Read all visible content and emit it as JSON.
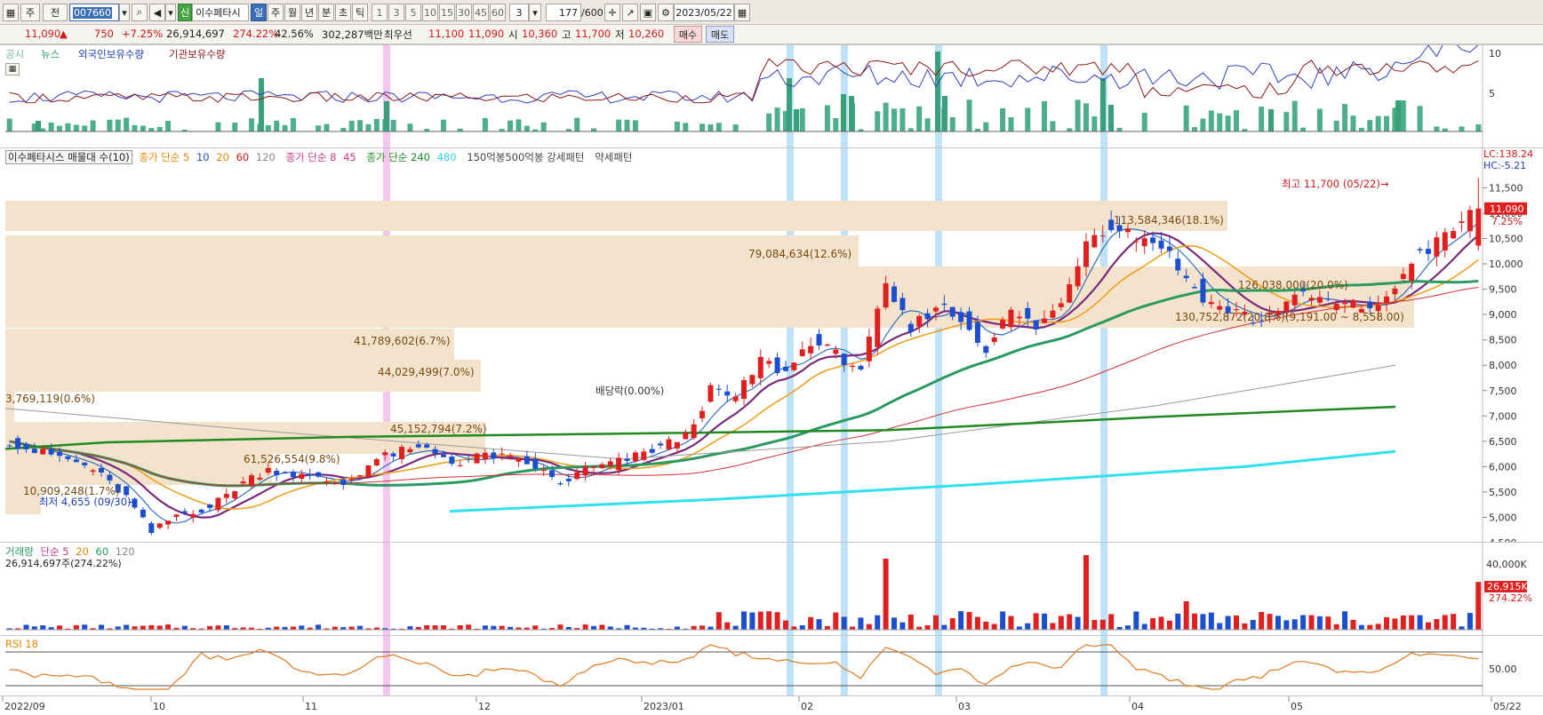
{
  "toolbar": {
    "period": "주",
    "prev": "전",
    "code": "007660",
    "shin": "신",
    "name": "이수페타시",
    "tabs": [
      "일",
      "주",
      "월",
      "년",
      "분",
      "초",
      "틱"
    ],
    "active_tab": "일",
    "intervals": [
      "1",
      "3",
      "5",
      "10",
      "15",
      "30",
      "45",
      "60"
    ],
    "interval_input": "3",
    "count": "177",
    "total": "/600",
    "date": "2023/05/22"
  },
  "quote": {
    "price": "11,090",
    "arrow": "▲",
    "change": "750",
    "change_pct": "+7.25%",
    "volume": "26,914,697",
    "vol_ratio": "274.22%",
    "turnover": "42.56%",
    "amount": "302,287백만",
    "best_label": "최우선",
    "ask": "11,100",
    "bid": "11,090",
    "open_label": "시",
    "open": "10,360",
    "high_label": "고",
    "high": "11,700",
    "low_label": "저",
    "low": "10,260",
    "buy": "매수",
    "sell": "매도"
  },
  "colors": {
    "up": "#e02020",
    "down": "#1c4fd0",
    "ma5": "#f0a020",
    "ma10": "#3070c0",
    "ma20": "#f0a020",
    "ma60": "#2a9a60",
    "ma120": "#9a9a9a",
    "ma240": "#208a20",
    "ma480": "#30e0f0",
    "profile": "#f3e3cc",
    "highlight_blue": "#bfe2f7",
    "highlight_pink": "#f7c6f0"
  },
  "top_panel": {
    "legend": [
      "공시",
      "뉴스",
      "외국인보유수량",
      "기관보유수량"
    ],
    "y_ticks": [
      "10",
      "5"
    ]
  },
  "price_panel": {
    "legend": {
      "title": "이수페타시스 매물대 수(10)",
      "ma_group1": "종가 단순 5",
      "ma_group1_values": [
        "10",
        "20",
        "60",
        "120"
      ],
      "ma_group2": "종가 단순 8",
      "ma_group2_value": "45",
      "ma_group3": "종가 단순 240",
      "ma_group3_value": "480",
      "pattern": "150억봉500억봉 강세패턴",
      "pattern2": "약세패턴"
    },
    "y_ticks": [
      "11,500",
      "11,000",
      "10,500",
      "10,000",
      "9,500",
      "9,000",
      "8,500",
      "8,000",
      "7,500",
      "7,000",
      "6,500",
      "6,000",
      "5,500",
      "5,000",
      "4,500"
    ],
    "lc": "LC:138.24",
    "hc": "HC:-5.21",
    "current_price": "11,090",
    "current_pct": "7.25%",
    "high_label": "최고 11,700 (05/22)",
    "low_label": "최저 4,655 (09/30)",
    "dividend_label": "배당락(0.00%)",
    "profile_labels": [
      "113,584,346(18.1%)",
      "79,084,634(12.6%)",
      "126,038,000(20.0%)",
      "130,752,872(20.8%)(9,191.00 ~ 8,558.00)",
      "41,789,602(6.7%)",
      "44,029,499(7.0%)",
      "3,769,119(0.6%)",
      "45,152,794(7.2%)",
      "61,526,554(9.8%)",
      "10,909,248(1.7%)"
    ]
  },
  "volume_panel": {
    "legend": [
      "거래량",
      "단순 5",
      "20",
      "60",
      "120"
    ],
    "sub": "26,914,697주(274.22%)",
    "y_tick": "40,000K",
    "current": "26,915K",
    "current_pct": "274.22%"
  },
  "rsi_panel": {
    "legend": "RSI 18",
    "y_tick": "50.00"
  },
  "x_axis": [
    "2022/09",
    "10",
    "11",
    "12",
    "2023/01",
    "02",
    "03",
    "04",
    "05",
    "05/22"
  ],
  "chart_data": {
    "type": "candlestick",
    "x": [
      "2022/09",
      "10",
      "11",
      "12",
      "2023/01",
      "02",
      "03",
      "04",
      "05",
      "05/22"
    ],
    "ylim": [
      4500,
      11700
    ],
    "close_path": [
      [
        0,
        6500
      ],
      [
        3,
        6300
      ],
      [
        6,
        6200
      ],
      [
        10,
        5950
      ],
      [
        14,
        5400
      ],
      [
        17,
        4700
      ],
      [
        20,
        5050
      ],
      [
        24,
        5200
      ],
      [
        28,
        5700
      ],
      [
        31,
        5950
      ],
      [
        34,
        5850
      ],
      [
        37,
        5750
      ],
      [
        40,
        5650
      ],
      [
        44,
        6150
      ],
      [
        47,
        6300
      ],
      [
        50,
        6350
      ],
      [
        54,
        6050
      ],
      [
        57,
        6250
      ],
      [
        60,
        6150
      ],
      [
        63,
        6000
      ],
      [
        66,
        5650
      ],
      [
        69,
        5950
      ],
      [
        72,
        6050
      ],
      [
        75,
        6200
      ],
      [
        78,
        6400
      ],
      [
        81,
        6600
      ],
      [
        84,
        7500
      ],
      [
        87,
        7350
      ],
      [
        90,
        8100
      ],
      [
        93,
        7850
      ],
      [
        96,
        8500
      ],
      [
        99,
        8200
      ],
      [
        102,
        7950
      ],
      [
        105,
        9500
      ],
      [
        108,
        8700
      ],
      [
        111,
        9200
      ],
      [
        114,
        8900
      ],
      [
        117,
        8350
      ],
      [
        120,
        9050
      ],
      [
        123,
        8750
      ],
      [
        126,
        9200
      ],
      [
        129,
        10500
      ],
      [
        132,
        10800
      ],
      [
        135,
        10550
      ],
      [
        138,
        10400
      ],
      [
        141,
        9700
      ],
      [
        144,
        9200
      ],
      [
        147,
        9050
      ],
      [
        150,
        8850
      ],
      [
        153,
        9300
      ],
      [
        156,
        9350
      ],
      [
        159,
        9200
      ],
      [
        162,
        9150
      ],
      [
        165,
        9250
      ],
      [
        168,
        10100
      ],
      [
        171,
        10400
      ],
      [
        176,
        11090
      ]
    ],
    "last_candle": {
      "open": 10360,
      "high": 11700,
      "low": 10260,
      "close": 11090
    },
    "high": {
      "value": 11700,
      "date": "05/22"
    },
    "low": {
      "value": 4655,
      "date": "09/30"
    },
    "volume_spikes": [
      [
        105,
        40000
      ],
      [
        129,
        42000
      ],
      [
        141,
        16000
      ],
      [
        150,
        10000
      ],
      [
        171,
        6000
      ],
      [
        176,
        26915
      ]
    ]
  }
}
